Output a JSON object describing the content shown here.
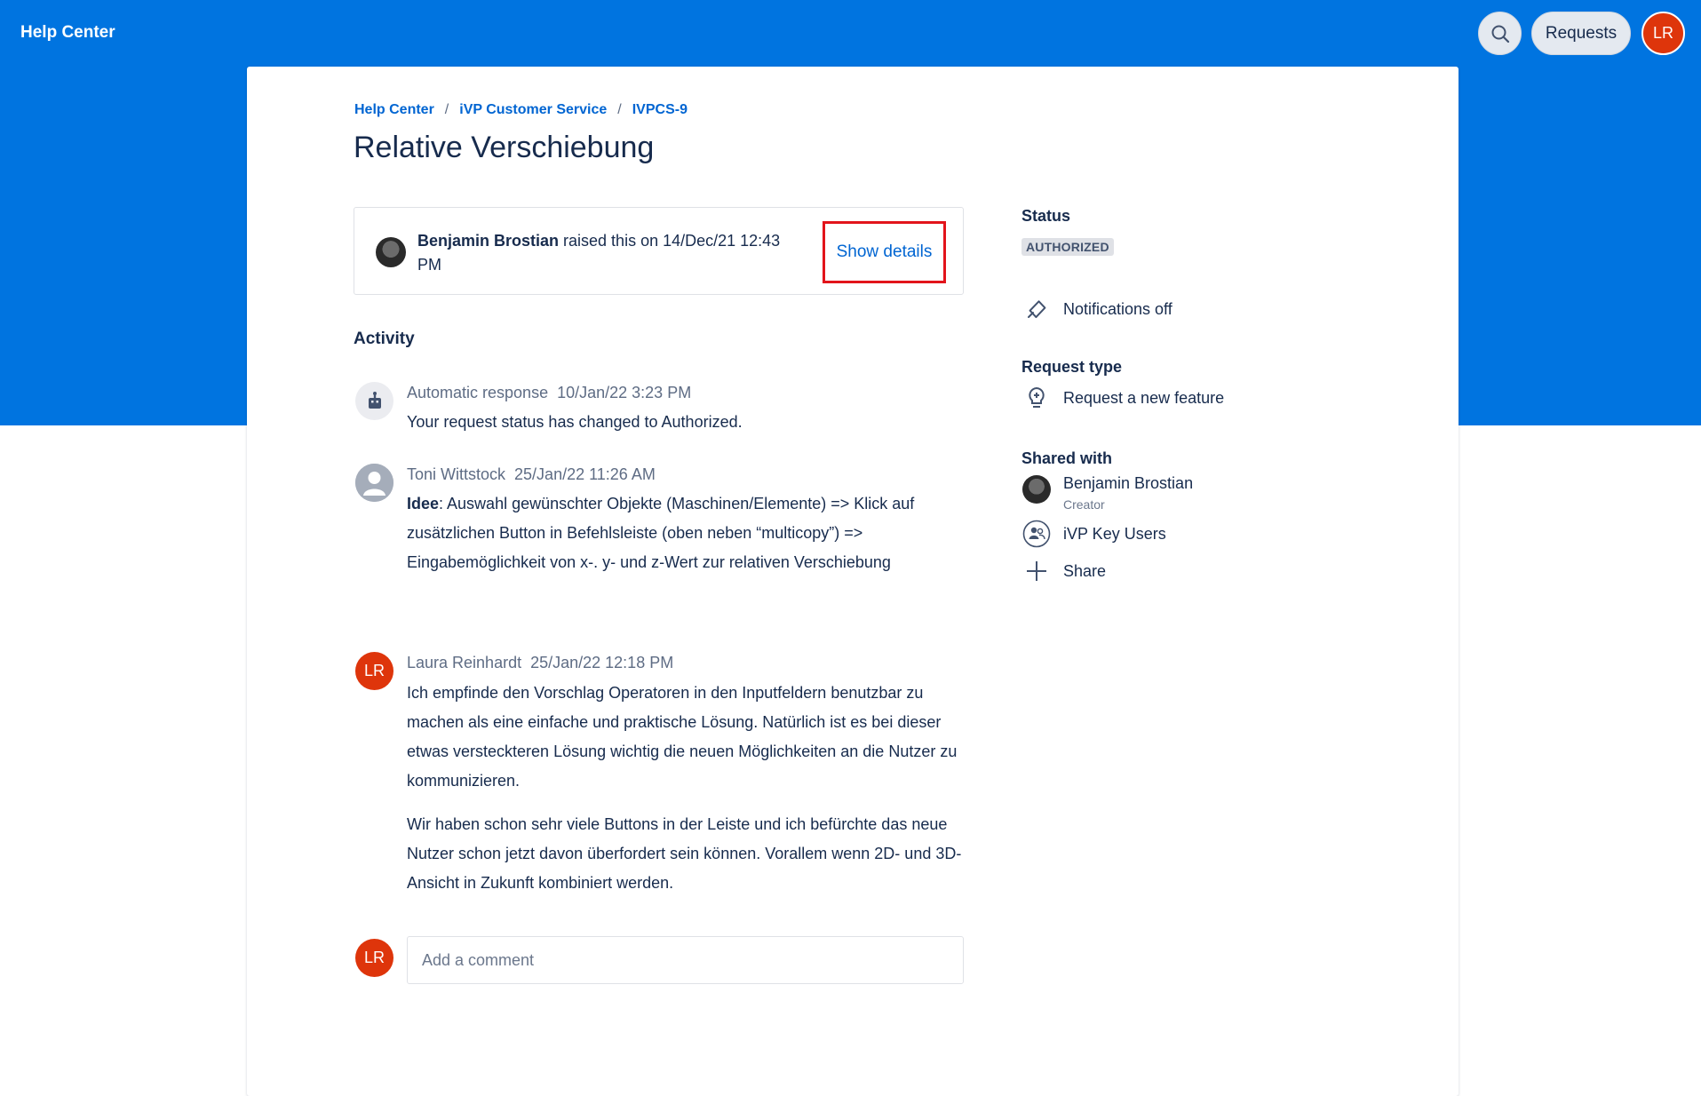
{
  "topbar": {
    "title": "Help Center",
    "requests_label": "Requests",
    "avatar_initials": "LR"
  },
  "breadcrumb": [
    "Help Center",
    "iVP Customer Service",
    "IVPCS-9"
  ],
  "page_title": "Relative Verschiebung",
  "raised": {
    "author": "Benjamin Brostian",
    "text": " raised this on 14/Dec/21 12:43 PM",
    "show_details": "Show details"
  },
  "activity": {
    "heading": "Activity",
    "entries": [
      {
        "author": "Automatic response",
        "time": "10/Jan/22 3:23 PM",
        "body": "Your request status has changed to Authorized."
      },
      {
        "author": "Toni Wittstock",
        "time": "25/Jan/22 11:26 AM",
        "body_bold": "Idee",
        "body": ": Auswahl gewünschter Objekte (Maschinen/Elemente) => Klick auf zusätzlichen Button in Befehlsleiste (oben neben “multicopy”) => Eingabemöglichkeit von x-. y- und z-Wert zur relativen Verschiebung"
      },
      {
        "author": "Laura Reinhardt",
        "time": "25/Jan/22 12:18 PM",
        "initials": "LR",
        "paragraph_1": "Ich empfinde den Vorschlag Operatoren in den Inputfeldern benutzbar zu machen als eine einfache und praktische Lösung. Natürlich ist es bei dieser etwas versteckteren Lösung wichtig die neuen Möglichkeiten an die Nutzer zu kommunizieren.",
        "paragraph_2": "Wir haben schon sehr viele Buttons in der Leiste und ich befürchte das neue Nutzer schon jetzt davon überfordert sein können. Vorallem wenn 2D- und 3D-Ansicht in Zukunft kombiniert werden."
      }
    ]
  },
  "comment": {
    "avatar_initials": "LR",
    "placeholder": "Add a comment"
  },
  "sidebar": {
    "status_label": "Status",
    "status_value": "AUTHORIZED",
    "notifications": "Notifications off",
    "request_type_label": "Request type",
    "request_type_value": "Request a new feature",
    "shared_with_label": "Shared with",
    "shared": [
      {
        "name": "Benjamin Brostian",
        "role": "Creator"
      },
      {
        "name": "iVP Key Users"
      }
    ],
    "share_label": "Share"
  },
  "colors": {
    "header_blue": "#0074e0",
    "link_blue": "#0065d2",
    "avatar_red": "#de350b",
    "highlight_red": "#e2141b"
  }
}
